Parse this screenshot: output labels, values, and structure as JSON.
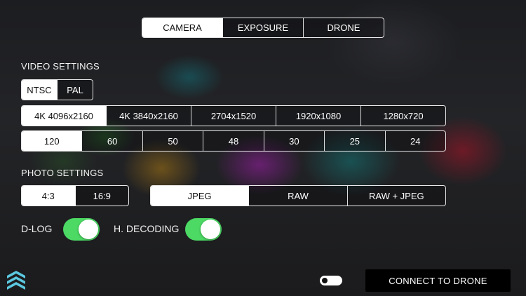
{
  "tabs": {
    "items": [
      "CAMERA",
      "EXPOSURE",
      "DRONE"
    ],
    "selected": "CAMERA"
  },
  "video_settings": {
    "label": "VIDEO SETTINGS",
    "standard": {
      "options": [
        "NTSC",
        "PAL"
      ],
      "selected": "NTSC"
    },
    "resolution": {
      "options": [
        "4K 4096x2160",
        "4K 3840x2160",
        "2704x1520",
        "1920x1080",
        "1280x720"
      ],
      "selected": "4K 4096x2160"
    },
    "frame_rate": {
      "options": [
        "120",
        "60",
        "50",
        "48",
        "30",
        "25",
        "24"
      ],
      "selected": "120"
    }
  },
  "photo_settings": {
    "label": "PHOTO SETTINGS",
    "aspect": {
      "options": [
        "4:3",
        "16:9"
      ],
      "selected": "4:3"
    },
    "format": {
      "options": [
        "JPEG",
        "RAW",
        "RAW + JPEG"
      ],
      "selected": "JPEG"
    }
  },
  "toggles": {
    "dlog": {
      "label": "D-LOG",
      "on": true
    },
    "h_decoding": {
      "label": "H. DECODING",
      "on": true
    }
  },
  "footer": {
    "connect_label": "CONNECT TO DRONE",
    "mini_toggle_on": false
  },
  "colors": {
    "switch_on": "#4cd964",
    "selected_segment": "#ffffff",
    "connect_bg": "#000000"
  },
  "icons": {
    "logo": "app-logo-icon"
  }
}
